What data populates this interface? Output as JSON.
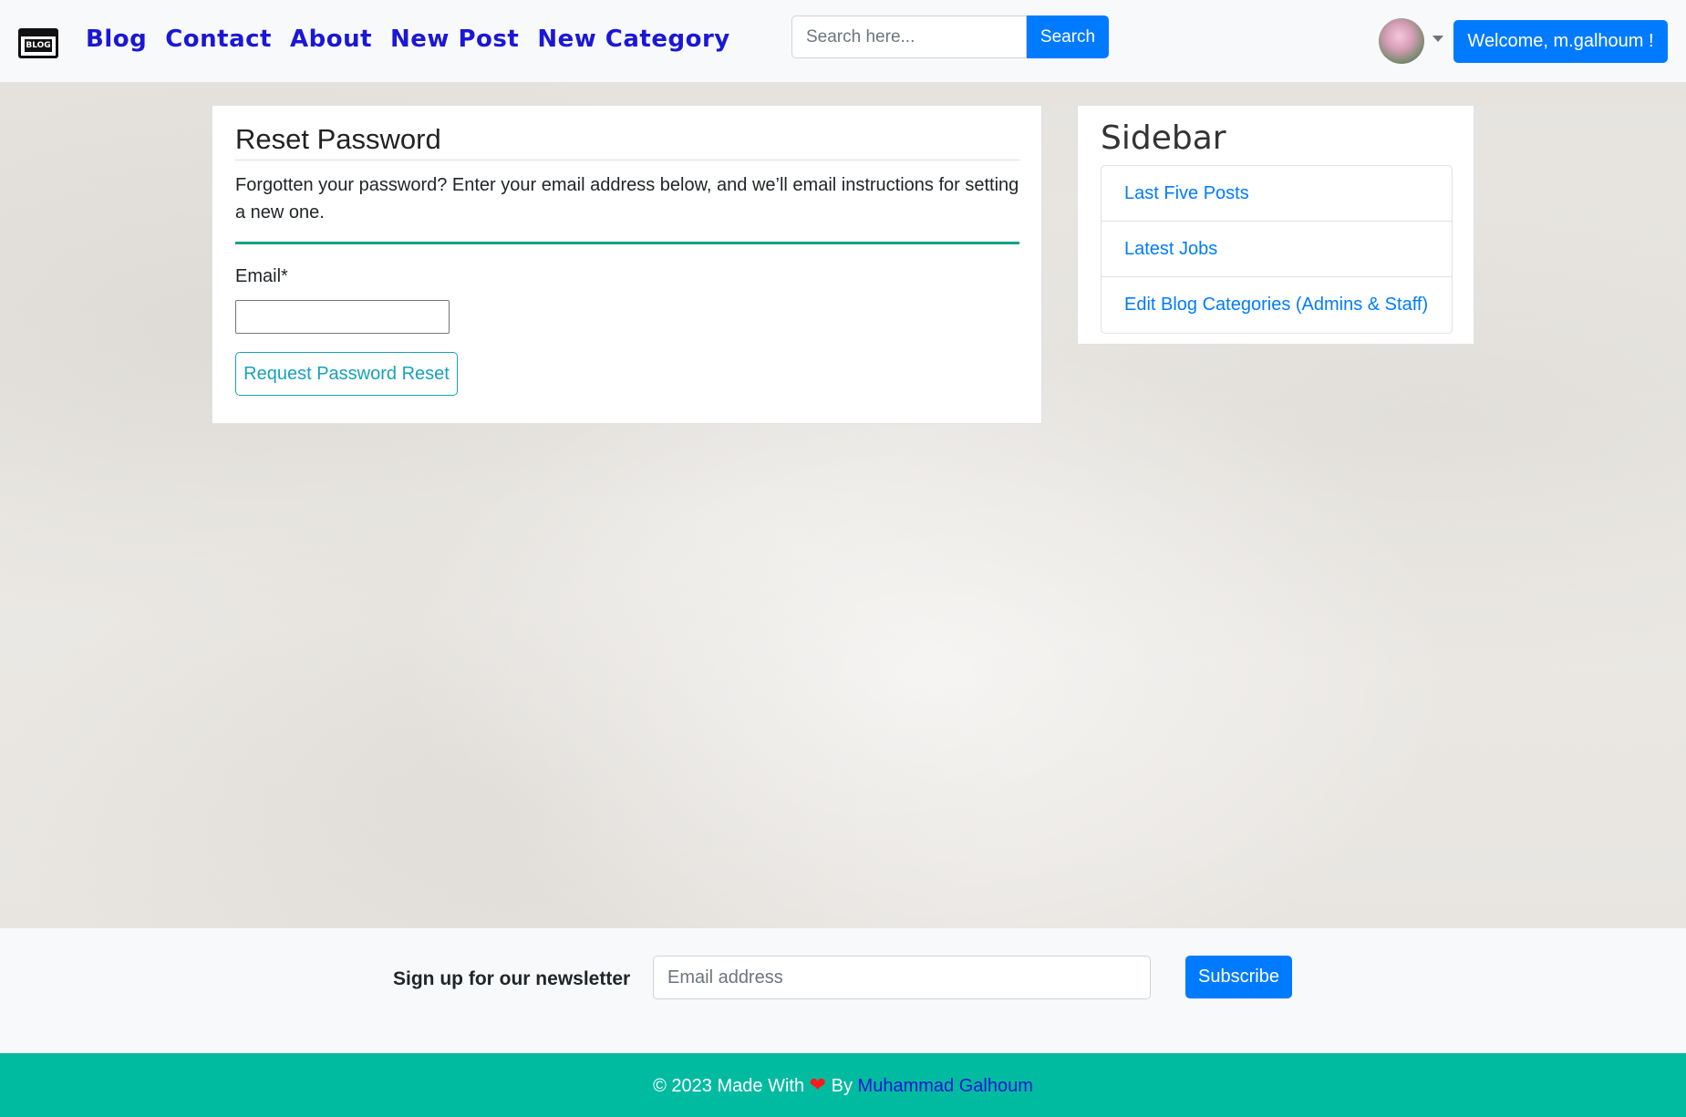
{
  "nav": {
    "logo_text": "BLOG",
    "links": [
      "Blog",
      "Contact",
      "About",
      "New Post",
      "New Category"
    ],
    "search_placeholder": "Search here...",
    "search_button": "Search",
    "welcome": "Welcome, m.galhoum !"
  },
  "reset": {
    "title": "Reset Password",
    "description": "Forgotten your password? Enter your email address below, and we’ll email instructions for setting a new one.",
    "email_label": "Email*",
    "submit": "Request Password Reset"
  },
  "sidebar": {
    "title": "Sidebar",
    "items": [
      "Last Five Posts",
      "Latest Jobs",
      "Edit Blog Categories (Admins & Staff)"
    ]
  },
  "newsletter": {
    "label": "Sign up for our newsletter",
    "placeholder": "Email address",
    "button": "Subscribe"
  },
  "footer": {
    "prefix": "© 2023 Made With",
    "by": "By",
    "author": "Muhammad Galhoum"
  },
  "colors": {
    "primary": "#007bff",
    "nav_link": "#1b17d6",
    "footer_bg": "#00bba0",
    "divider_teal": "#17a08a"
  }
}
